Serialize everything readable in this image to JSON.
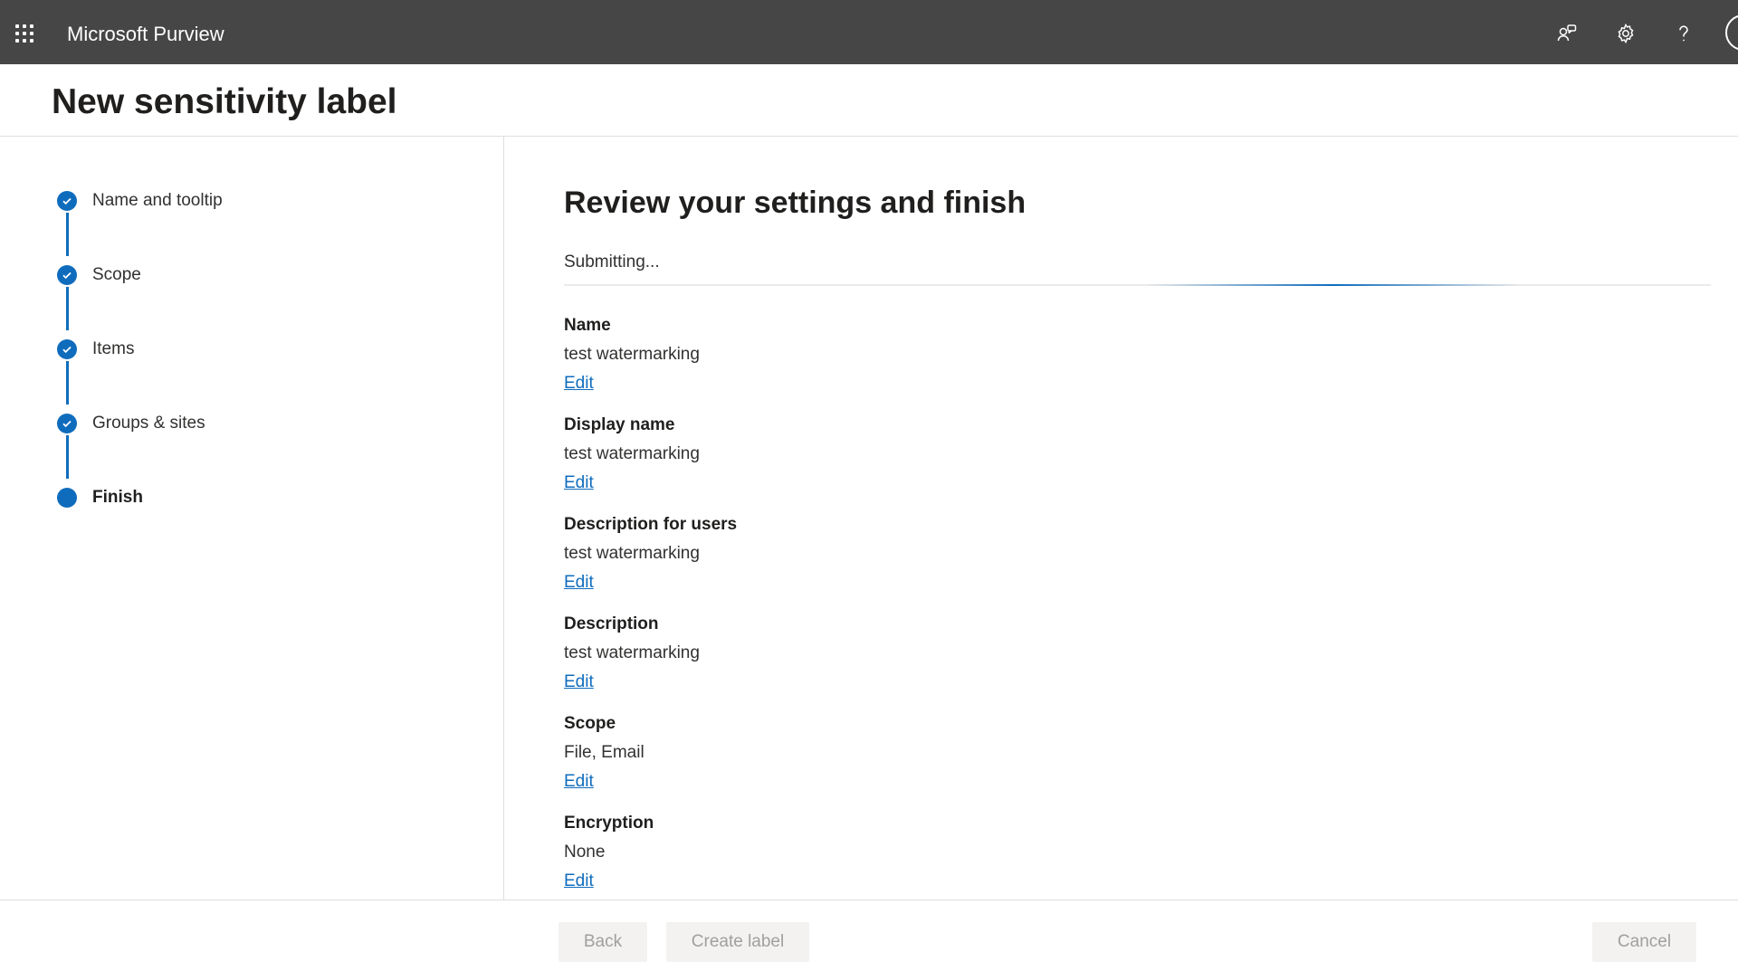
{
  "topbar": {
    "app_title": "Microsoft Purview",
    "icons": [
      "app-launcher-icon",
      "community-icon",
      "settings-icon",
      "help-icon",
      "avatar"
    ]
  },
  "page": {
    "title": "New sensitivity label"
  },
  "stepper": {
    "steps": [
      {
        "label": "Name and tooltip",
        "state": "completed"
      },
      {
        "label": "Scope",
        "state": "completed"
      },
      {
        "label": "Items",
        "state": "completed"
      },
      {
        "label": "Groups & sites",
        "state": "completed"
      },
      {
        "label": "Finish",
        "state": "current"
      }
    ]
  },
  "main": {
    "title": "Review your settings and finish",
    "status": "Submitting...",
    "sections": [
      {
        "heading": "Name",
        "value": "test watermarking",
        "edit": "Edit"
      },
      {
        "heading": "Display name",
        "value": "test watermarking",
        "edit": "Edit"
      },
      {
        "heading": "Description for users",
        "value": "test watermarking",
        "edit": "Edit"
      },
      {
        "heading": "Description",
        "value": "test watermarking",
        "edit": "Edit"
      },
      {
        "heading": "Scope",
        "value": "File, Email",
        "edit": "Edit"
      },
      {
        "heading": "Encryption",
        "value": "None",
        "edit": "Edit"
      }
    ]
  },
  "footer": {
    "back": "Back",
    "create": "Create label",
    "cancel": "Cancel"
  },
  "colors": {
    "topbar_bg": "#464646",
    "accent": "#0f6cbd",
    "disabled_button_bg": "#f3f2f1",
    "disabled_button_text": "#a19f9d"
  }
}
